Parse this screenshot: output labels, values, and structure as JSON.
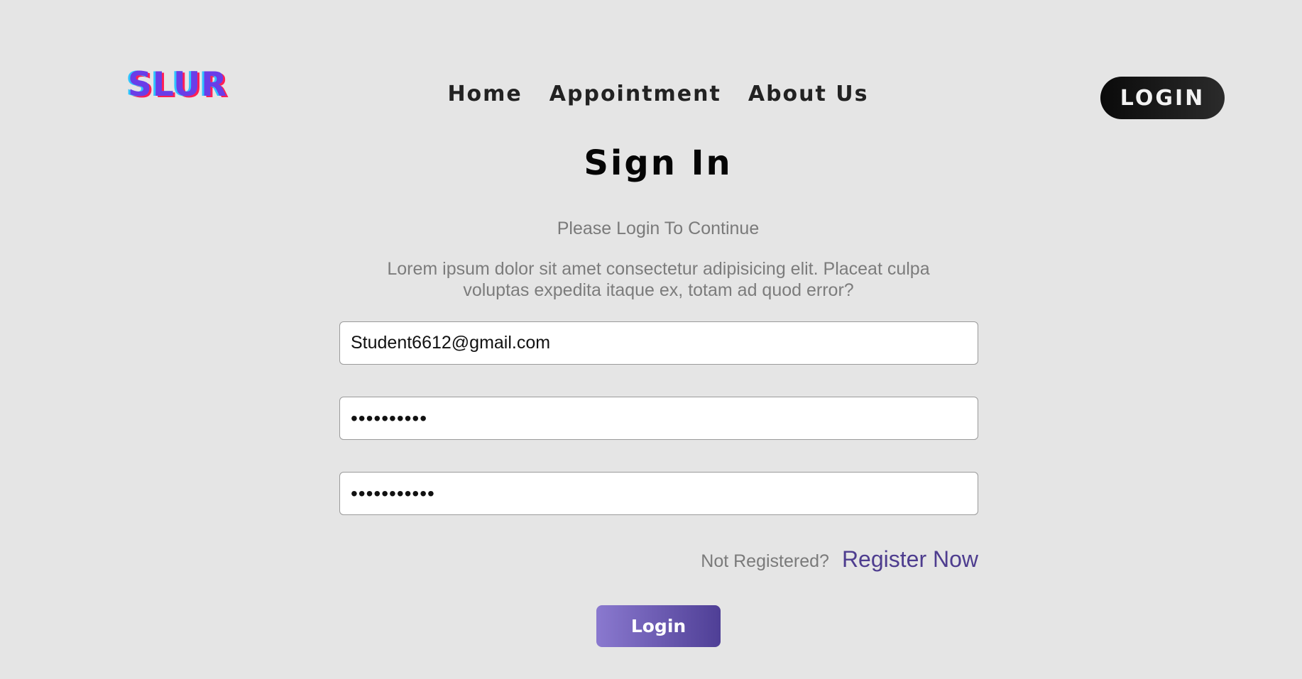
{
  "brand": {
    "logo_text": "SLUR"
  },
  "nav": {
    "items": [
      {
        "label": "Home"
      },
      {
        "label": "Appointment"
      },
      {
        "label": "About Us"
      }
    ],
    "login_label": "LOGIN"
  },
  "form": {
    "title": "Sign In",
    "subtitle": "Please Login To Continue",
    "description": "Lorem ipsum dolor sit amet consectetur adipisicing elit. Placeat culpa voluptas expedita itaque ex, totam ad quod error?",
    "email_value": "Student6612@gmail.com",
    "password_value": "••••••••••",
    "confirm_password_value": "•••••••••••",
    "not_registered_text": "Not Registered?",
    "register_link": "Register Now",
    "submit_label": "Login"
  },
  "colors": {
    "background": "#e5e5e5",
    "logo_primary": "#6a3de8",
    "logo_shadow_left": "#2ec4ff",
    "logo_shadow_right": "#ff1f56",
    "login_pill": "#111111",
    "register_link": "#4e3d8f",
    "submit_gradient_start": "#8a79cf",
    "submit_gradient_end": "#4f3f96"
  }
}
